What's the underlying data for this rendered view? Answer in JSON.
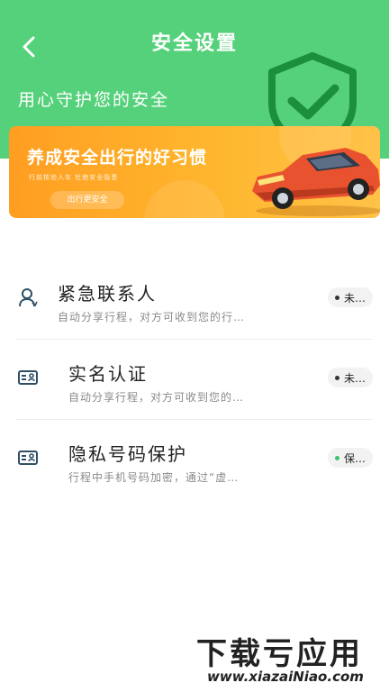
{
  "header": {
    "title": "安全设置",
    "subtitle": "用心守护您的安全",
    "back_icon": "chevron-left-icon",
    "shield_icon": "shield-check-icon",
    "color": "#56d17b"
  },
  "banner": {
    "headline": "养成安全出行的好习惯",
    "small_text": "行前核验人车    杜绝安全隐患",
    "button_label": "出行更安全"
  },
  "items": [
    {
      "title": "紧急联系人",
      "desc": "自动分享行程，对方可收到您的行…",
      "status": "未…",
      "icon": "contact-person-icon"
    },
    {
      "title": "实名认证",
      "desc": "自动分享行程，对方可收到您的…",
      "status": "未…",
      "icon": "id-card-icon"
    },
    {
      "title": "隐私号码保护",
      "desc": "行程中手机号码加密，通过“虚…",
      "status": "保…",
      "icon": "id-card-icon"
    }
  ],
  "watermark": {
    "title": "下载亏应用",
    "url": "www.xiazaiNiao.com"
  }
}
